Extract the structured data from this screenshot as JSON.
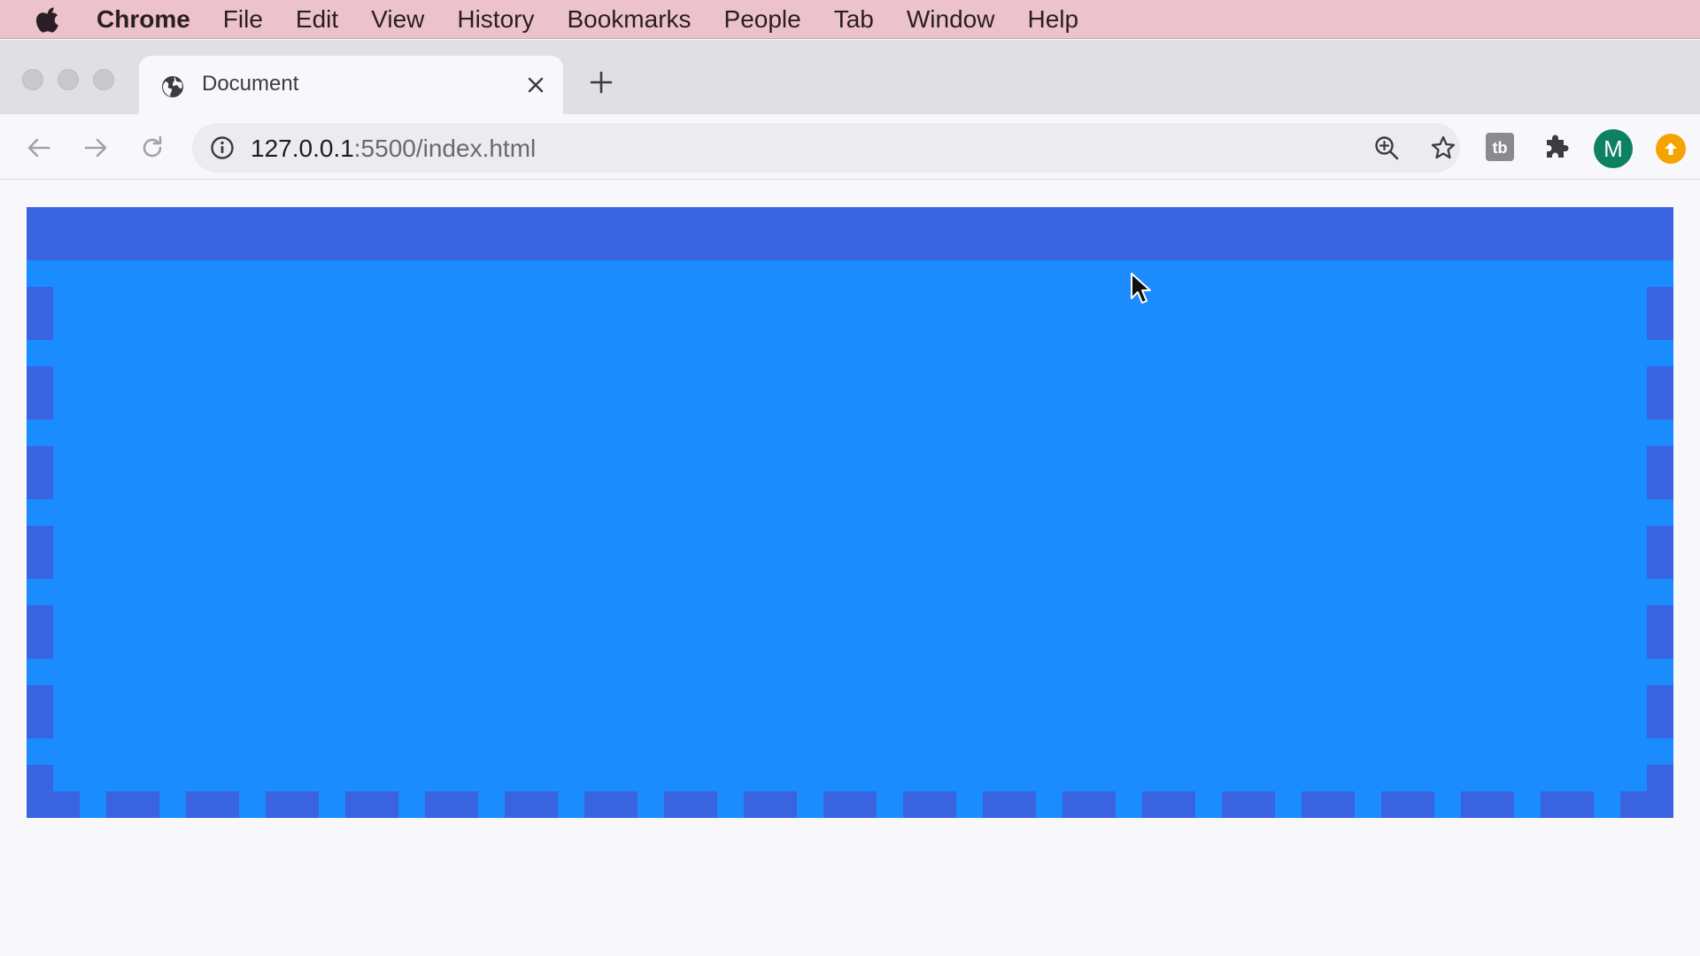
{
  "menubar": {
    "apple_icon": "apple-logo-icon",
    "items": [
      {
        "label": "Chrome",
        "app": true
      },
      {
        "label": "File"
      },
      {
        "label": "Edit"
      },
      {
        "label": "View"
      },
      {
        "label": "History"
      },
      {
        "label": "Bookmarks"
      },
      {
        "label": "People"
      },
      {
        "label": "Tab"
      },
      {
        "label": "Window"
      },
      {
        "label": "Help"
      }
    ]
  },
  "tabs": [
    {
      "title": "Document",
      "favicon": "globe-icon",
      "active": true
    }
  ],
  "toolbar": {
    "url_host": "127.0.0.1",
    "url_path": ":5500/index.html",
    "profile_initial": "M"
  },
  "page": {
    "box_fill": "#1a8cfe",
    "box_border": "#3a63e0",
    "background": "#f8f7fb"
  },
  "colors": {
    "menubar": "#ecc3cc",
    "tabstrip": "#dfdfe4",
    "avatar": "#0e8163",
    "update_badge": "#f5a300"
  }
}
